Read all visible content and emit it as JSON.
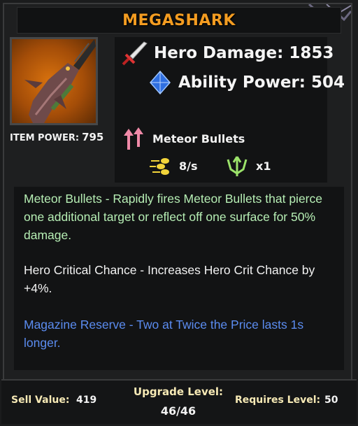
{
  "item": {
    "name": "MEGASHARK",
    "item_power_label": "ITEM POWER:",
    "item_power_value": "795"
  },
  "stats": {
    "hero_damage": "Hero Damage: 1853",
    "ability_power": "Ability Power: 504",
    "weapon_name": "Meteor Bullets",
    "fire_rate": "8/s",
    "pierce_count": "x1"
  },
  "description": {
    "line1": "Meteor Bullets - Rapidly fires Meteor Bullets that pierce one additional target or reflect off one surface for 50% damage.",
    "line2": "Hero Critical Chance - Increases Hero Crit Chance by +4%.",
    "line3": "Magazine Reserve - Two at Twice the Price lasts 1s longer."
  },
  "footer": {
    "sell_label": "Sell Value:",
    "sell_value": "419",
    "upgrade_label": "Upgrade Level:",
    "upgrade_value": "46/46",
    "requires_label": "Requires Level:",
    "requires_value": "50"
  },
  "colors": {
    "title": "#f39c21",
    "desc_green": "#b6eeb4",
    "desc_white": "#f2f2f2",
    "desc_blue": "#5b8cf0",
    "footer_label": "#f6e9b5"
  },
  "icons": {
    "damage": "sword-icon",
    "ability": "blue-diamond-icon",
    "weapon": "pink-arrows-icon",
    "fire_rate": "yellow-bullets-icon",
    "pierce": "green-trident-icon"
  }
}
